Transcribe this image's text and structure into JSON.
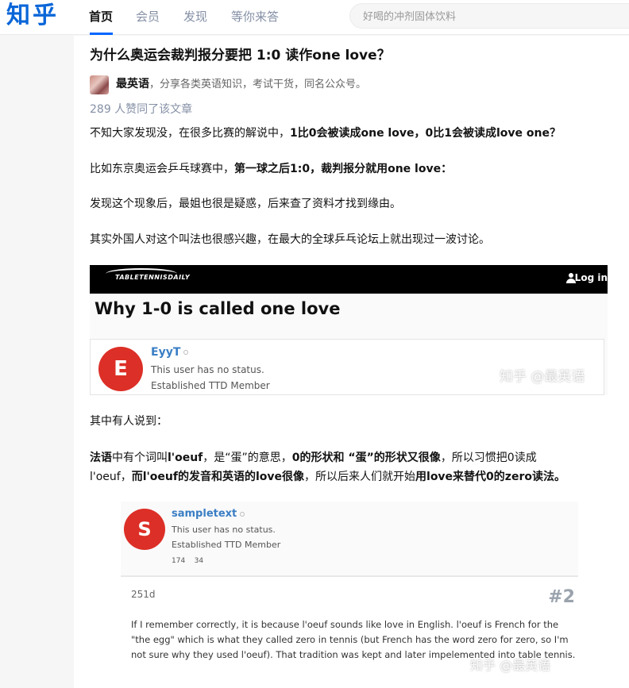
{
  "header": {
    "logo": "知乎",
    "nav": [
      "首页",
      "会员",
      "发现",
      "等你来答"
    ],
    "search_placeholder": "好喝的冲剂固体饮料"
  },
  "article": {
    "title": "为什么奥运会裁判报分要把 1:0 读作one love？",
    "author_name": "最英语",
    "author_bio": "，分享各类英语知识，考试干货，同名公众号。",
    "likes": "289 人赞同了该文章",
    "p1_a": "不知大家发现没，在很多比赛的解说中，",
    "p1_b": "1比0会被读成one love，0比1会被读成love one？",
    "p2_a": "比如东京奥运会乒乓球赛中，",
    "p2_b": "第一球之后1:0，裁判报分就用one love：",
    "p3": "发现这个现象后，最姐也很是疑惑，后来查了资料才找到缘由。",
    "p4": "其实外国人对这个叫法也很感兴趣，在最大的全球乒乓论坛上就出现过一波讨论。",
    "p5": "其中有人说到：",
    "p6_1": "法语",
    "p6_2": "中有个词叫",
    "p6_3": "l'oeuf",
    "p6_4": "，是“蛋”的意思，",
    "p6_5": "0的形状和 “蛋”的形状又很像",
    "p6_6": "，所以习惯把0读成",
    "p7_1": "l'oeuf，",
    "p7_2": "而l'oeuf的发音和英语的love很像",
    "p7_3": "，所以后来人们就开始",
    "p7_4": "用love来替代0的zero读法。"
  },
  "screenshot1": {
    "site": "TABLETENNISDAILY",
    "login": "Log in",
    "heading": "Why 1-0 is called one love",
    "avatar_letter": "E",
    "user": "EyyT",
    "status": "This user has no status.",
    "member": "Established TTD Member",
    "watermark": "知乎 @最英语"
  },
  "screenshot2": {
    "avatar_letter": "S",
    "user": "sampletext",
    "status": "This user has no status.",
    "member": "Established TTD Member",
    "stat1": "174",
    "stat2": "34",
    "age": "251d",
    "post_number": "#2",
    "post_text": "If I remember correctly, it is because l'oeuf sounds like love in English. l'oeuf is French for the \"the egg\" which is what they called zero in tennis (but French has the word zero for zero, so I'm not sure why they used l'oeuf). That tradition was kept and later impelemented into table tennis.",
    "watermark": "知乎 @最英语"
  },
  "colors": {
    "brand": "#0a66d8",
    "nav_active_underline": "#0066ff",
    "avatar_red": "#dc2f27",
    "username_blue": "#3a7ec4"
  }
}
